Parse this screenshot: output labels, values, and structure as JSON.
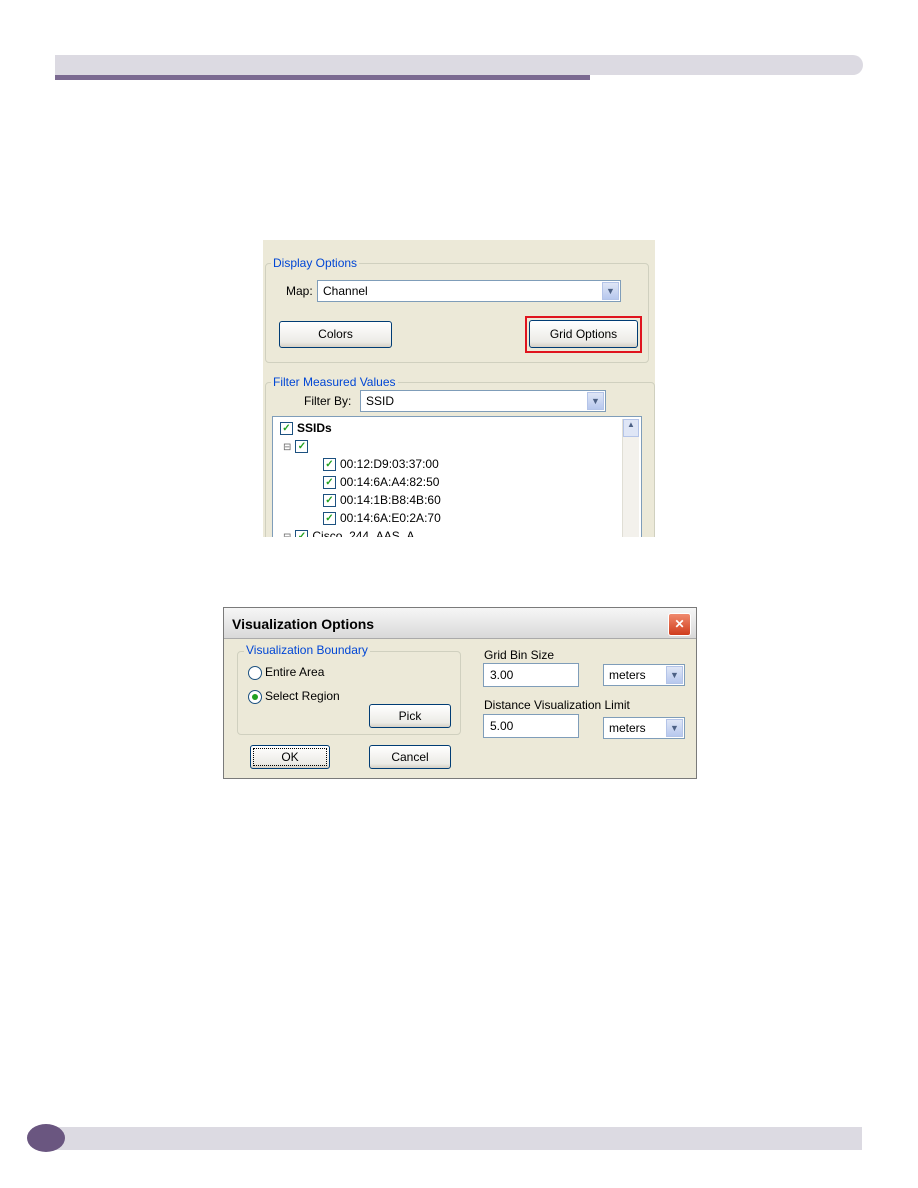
{
  "display_panel": {
    "display_options_legend": "Display Options",
    "map_label": "Map:",
    "map_value": "Channel",
    "colors_button": "Colors",
    "grid_options_button": "Grid Options",
    "highlight_color": "#e0141e",
    "filter_legend": "Filter Measured Values",
    "filter_by_label": "Filter By:",
    "filter_by_value": "SSID",
    "tree": {
      "root": "SSIDs",
      "children": [
        "00:12:D9:03:37:00",
        "00:14:6A:A4:82:50",
        "00:14:1B:B8:4B:60",
        "00:14:6A:E0:2A:70"
      ],
      "next_partial": "Cisco_244_AAS_A"
    }
  },
  "dialog": {
    "title": "Visualization Options",
    "boundary_legend": "Visualization Boundary",
    "entire_area": "Entire Area",
    "select_region": "Select Region",
    "selected": "Select Region",
    "pick_button": "Pick",
    "ok_button": "OK",
    "cancel_button": "Cancel",
    "grid_bin_label": "Grid Bin Size",
    "grid_bin_value": "3.00",
    "grid_bin_unit": "meters",
    "distance_label": "Distance Visualization Limit",
    "distance_value": "5.00",
    "distance_unit": "meters"
  }
}
